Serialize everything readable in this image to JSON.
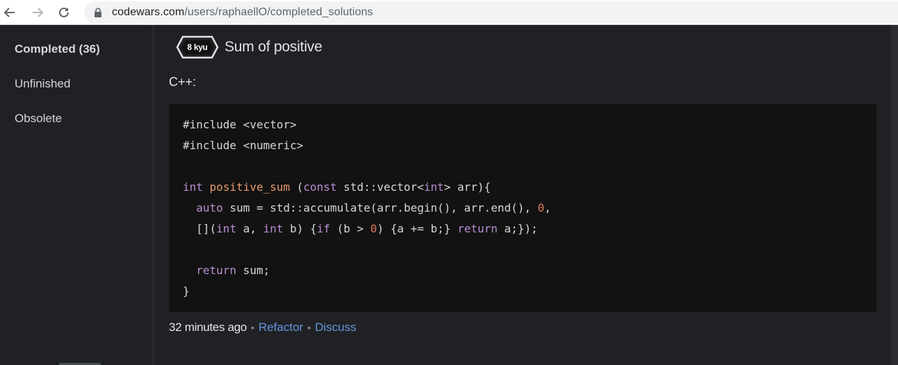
{
  "browser": {
    "url_host": "codewars.com",
    "url_path": "/users/raphaellO/completed_solutions"
  },
  "sidebar": {
    "items": [
      {
        "label": "Completed (36)",
        "active": true
      },
      {
        "label": "Unfinished",
        "active": false
      },
      {
        "label": "Obsolete",
        "active": false
      }
    ]
  },
  "kata": {
    "rank": "8 kyu",
    "title": "Sum of positive",
    "language": "C++:"
  },
  "code": {
    "lines": [
      "#include <vector>",
      "#include <numeric>",
      "",
      "int positive_sum (const std::vector<int> arr){",
      "  auto sum = std::accumulate(arr.begin(), arr.end(), 0,",
      "  [](int a, int b) {if (b > 0) {a += b;} return a;});",
      "",
      "  return sum;",
      "}"
    ]
  },
  "meta": {
    "time": "32 minutes ago",
    "separator": "•",
    "refactor_label": "Refactor",
    "discuss_label": "Discuss"
  },
  "colors": {
    "background": "#1f2124",
    "code_background": "#121212",
    "link": "#6795de",
    "keyword": "#b98ed1",
    "function": "#e49b6c",
    "number": "#e07a5f"
  },
  "icons": {
    "back": "arrow-left-icon",
    "forward": "arrow-right-icon",
    "reload": "reload-icon",
    "lock": "lock-icon"
  }
}
